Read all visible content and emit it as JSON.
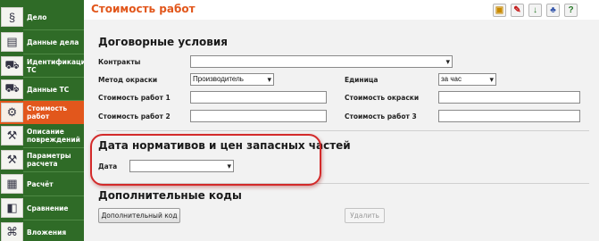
{
  "sidebar": {
    "items": [
      {
        "label": "Дело",
        "icon": "folder-icon",
        "active": false
      },
      {
        "label": "Данные дела",
        "icon": "documents-icon",
        "active": false
      },
      {
        "label": "Идентификация ТС",
        "icon": "car-id-icon",
        "active": false
      },
      {
        "label": "Данные ТС",
        "icon": "car-icon",
        "active": false
      },
      {
        "label": "Стоимость работ",
        "icon": "gears-icon",
        "active": true
      },
      {
        "label": "Описание повреждений",
        "icon": "wrench-icon",
        "active": false
      },
      {
        "label": "Параметры расчета",
        "icon": "hammer-icon",
        "active": false
      },
      {
        "label": "Расчёт",
        "icon": "calculator-icon",
        "active": false
      },
      {
        "label": "Сравнение",
        "icon": "compare-icon",
        "active": false
      },
      {
        "label": "Вложения",
        "icon": "attachment-icon",
        "active": false
      }
    ]
  },
  "header": {
    "title": "Стоимость работ",
    "toolbar": [
      "save-icon",
      "pdf-icon",
      "download-icon",
      "people-icon",
      "help-icon"
    ]
  },
  "contract": {
    "title": "Договорные условия",
    "contracts_label": "Контракты",
    "contracts_value": "",
    "paint_method_label": "Метод окраски",
    "paint_method_value": "Производитель",
    "unit_label": "Единица",
    "unit_value": "за час",
    "labor1_label": "Стоимость работ 1",
    "labor1_value": "",
    "paint_cost_label": "Стоимость окраски",
    "paint_cost_value": "",
    "labor2_label": "Стоимость работ 2",
    "labor2_value": "",
    "labor3_label": "Стоимость работ 3",
    "labor3_value": ""
  },
  "dates": {
    "title": "Дата нормативов и цен запасных частей",
    "date_label": "Дата",
    "date_value": ""
  },
  "extra": {
    "title": "Дополнительные коды",
    "add_button": "Дополнительный код",
    "delete_button": "Удалить"
  },
  "colors": {
    "accent": "#e2571c",
    "sidebar": "#2f6b27",
    "highlight": "#d32a2a"
  }
}
